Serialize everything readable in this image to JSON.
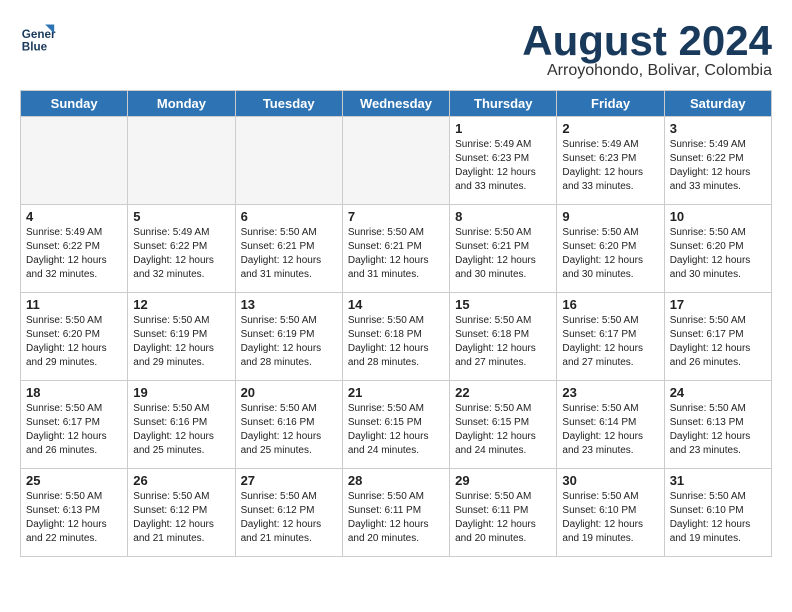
{
  "header": {
    "logo_line1": "General",
    "logo_line2": "Blue",
    "month_title": "August 2024",
    "subtitle": "Arroyohondo, Bolivar, Colombia"
  },
  "days_of_week": [
    "Sunday",
    "Monday",
    "Tuesday",
    "Wednesday",
    "Thursday",
    "Friday",
    "Saturday"
  ],
  "weeks": [
    [
      {
        "day": "",
        "info": ""
      },
      {
        "day": "",
        "info": ""
      },
      {
        "day": "",
        "info": ""
      },
      {
        "day": "",
        "info": ""
      },
      {
        "day": "1",
        "info": "Sunrise: 5:49 AM\nSunset: 6:23 PM\nDaylight: 12 hours\nand 33 minutes."
      },
      {
        "day": "2",
        "info": "Sunrise: 5:49 AM\nSunset: 6:23 PM\nDaylight: 12 hours\nand 33 minutes."
      },
      {
        "day": "3",
        "info": "Sunrise: 5:49 AM\nSunset: 6:22 PM\nDaylight: 12 hours\nand 33 minutes."
      }
    ],
    [
      {
        "day": "4",
        "info": "Sunrise: 5:49 AM\nSunset: 6:22 PM\nDaylight: 12 hours\nand 32 minutes."
      },
      {
        "day": "5",
        "info": "Sunrise: 5:49 AM\nSunset: 6:22 PM\nDaylight: 12 hours\nand 32 minutes."
      },
      {
        "day": "6",
        "info": "Sunrise: 5:50 AM\nSunset: 6:21 PM\nDaylight: 12 hours\nand 31 minutes."
      },
      {
        "day": "7",
        "info": "Sunrise: 5:50 AM\nSunset: 6:21 PM\nDaylight: 12 hours\nand 31 minutes."
      },
      {
        "day": "8",
        "info": "Sunrise: 5:50 AM\nSunset: 6:21 PM\nDaylight: 12 hours\nand 30 minutes."
      },
      {
        "day": "9",
        "info": "Sunrise: 5:50 AM\nSunset: 6:20 PM\nDaylight: 12 hours\nand 30 minutes."
      },
      {
        "day": "10",
        "info": "Sunrise: 5:50 AM\nSunset: 6:20 PM\nDaylight: 12 hours\nand 30 minutes."
      }
    ],
    [
      {
        "day": "11",
        "info": "Sunrise: 5:50 AM\nSunset: 6:20 PM\nDaylight: 12 hours\nand 29 minutes."
      },
      {
        "day": "12",
        "info": "Sunrise: 5:50 AM\nSunset: 6:19 PM\nDaylight: 12 hours\nand 29 minutes."
      },
      {
        "day": "13",
        "info": "Sunrise: 5:50 AM\nSunset: 6:19 PM\nDaylight: 12 hours\nand 28 minutes."
      },
      {
        "day": "14",
        "info": "Sunrise: 5:50 AM\nSunset: 6:18 PM\nDaylight: 12 hours\nand 28 minutes."
      },
      {
        "day": "15",
        "info": "Sunrise: 5:50 AM\nSunset: 6:18 PM\nDaylight: 12 hours\nand 27 minutes."
      },
      {
        "day": "16",
        "info": "Sunrise: 5:50 AM\nSunset: 6:17 PM\nDaylight: 12 hours\nand 27 minutes."
      },
      {
        "day": "17",
        "info": "Sunrise: 5:50 AM\nSunset: 6:17 PM\nDaylight: 12 hours\nand 26 minutes."
      }
    ],
    [
      {
        "day": "18",
        "info": "Sunrise: 5:50 AM\nSunset: 6:17 PM\nDaylight: 12 hours\nand 26 minutes."
      },
      {
        "day": "19",
        "info": "Sunrise: 5:50 AM\nSunset: 6:16 PM\nDaylight: 12 hours\nand 25 minutes."
      },
      {
        "day": "20",
        "info": "Sunrise: 5:50 AM\nSunset: 6:16 PM\nDaylight: 12 hours\nand 25 minutes."
      },
      {
        "day": "21",
        "info": "Sunrise: 5:50 AM\nSunset: 6:15 PM\nDaylight: 12 hours\nand 24 minutes."
      },
      {
        "day": "22",
        "info": "Sunrise: 5:50 AM\nSunset: 6:15 PM\nDaylight: 12 hours\nand 24 minutes."
      },
      {
        "day": "23",
        "info": "Sunrise: 5:50 AM\nSunset: 6:14 PM\nDaylight: 12 hours\nand 23 minutes."
      },
      {
        "day": "24",
        "info": "Sunrise: 5:50 AM\nSunset: 6:13 PM\nDaylight: 12 hours\nand 23 minutes."
      }
    ],
    [
      {
        "day": "25",
        "info": "Sunrise: 5:50 AM\nSunset: 6:13 PM\nDaylight: 12 hours\nand 22 minutes."
      },
      {
        "day": "26",
        "info": "Sunrise: 5:50 AM\nSunset: 6:12 PM\nDaylight: 12 hours\nand 21 minutes."
      },
      {
        "day": "27",
        "info": "Sunrise: 5:50 AM\nSunset: 6:12 PM\nDaylight: 12 hours\nand 21 minutes."
      },
      {
        "day": "28",
        "info": "Sunrise: 5:50 AM\nSunset: 6:11 PM\nDaylight: 12 hours\nand 20 minutes."
      },
      {
        "day": "29",
        "info": "Sunrise: 5:50 AM\nSunset: 6:11 PM\nDaylight: 12 hours\nand 20 minutes."
      },
      {
        "day": "30",
        "info": "Sunrise: 5:50 AM\nSunset: 6:10 PM\nDaylight: 12 hours\nand 19 minutes."
      },
      {
        "day": "31",
        "info": "Sunrise: 5:50 AM\nSunset: 6:10 PM\nDaylight: 12 hours\nand 19 minutes."
      }
    ]
  ]
}
